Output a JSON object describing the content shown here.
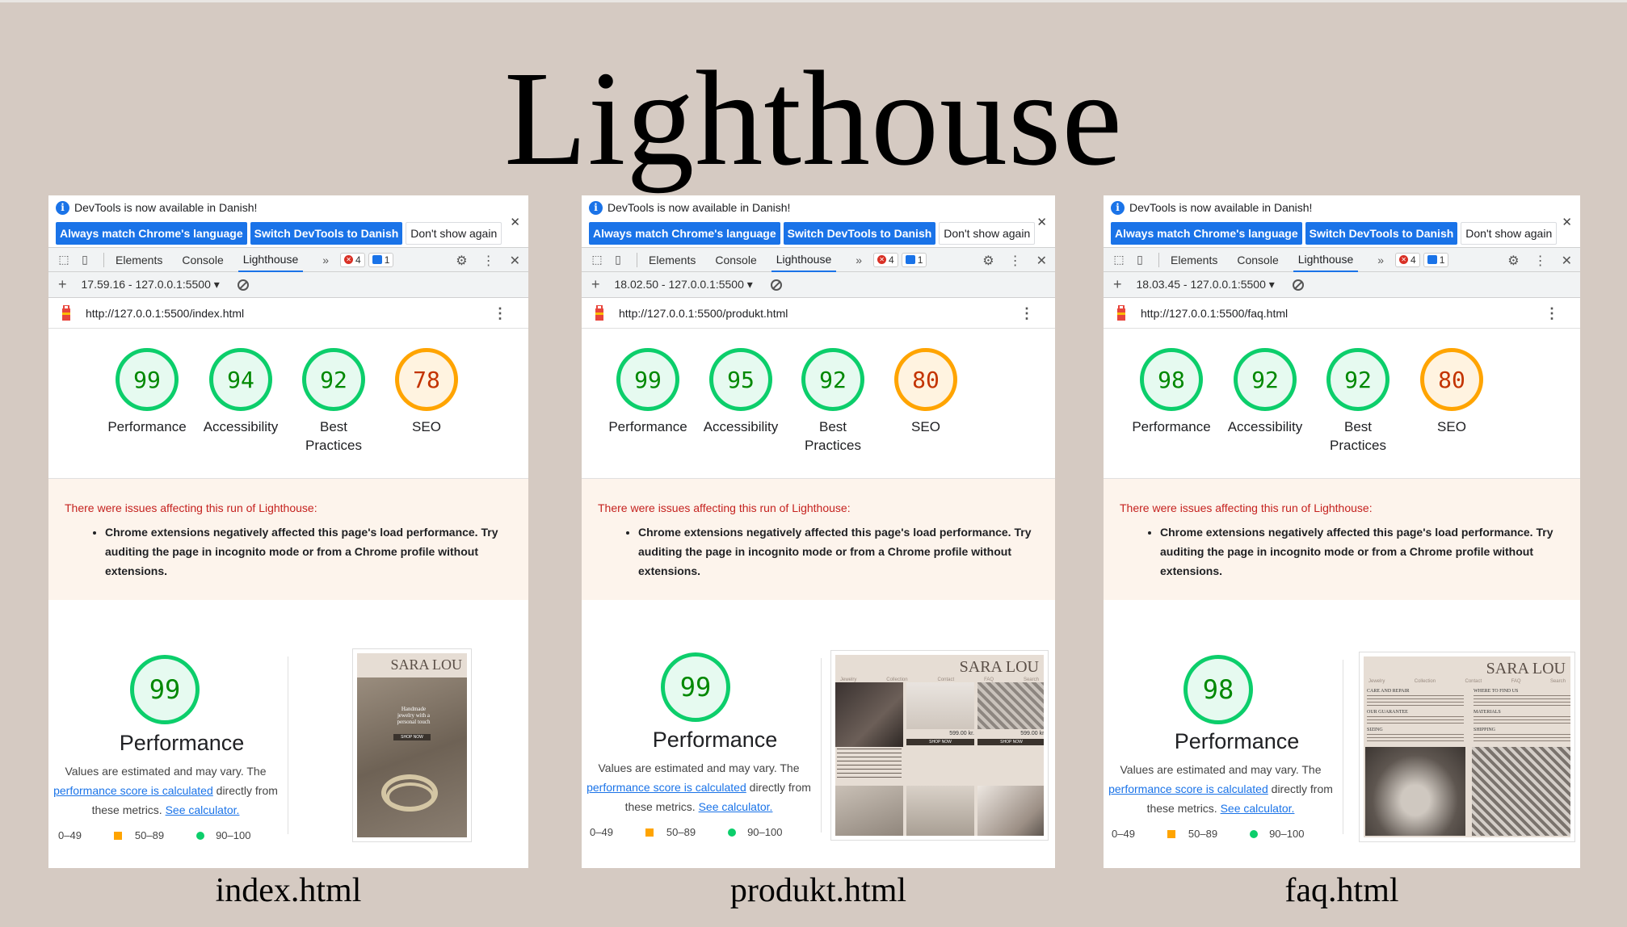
{
  "title": "Lighthouse",
  "common": {
    "banner_text": "DevTools is now available in Danish!",
    "btn_match": "Always match Chrome's language",
    "btn_switch": "Switch DevTools to Danish",
    "btn_dont": "Don't show again",
    "tab_elements": "Elements",
    "tab_console": "Console",
    "tab_lighthouse": "Lighthouse",
    "more_tabs": "»",
    "errors_count": "4",
    "messages_count": "1",
    "label_performance": "Performance",
    "label_accessibility": "Accessibility",
    "label_best_practices": "Best Practices",
    "label_seo": "SEO",
    "warn_title": "There were issues affecting this run of Lighthouse:",
    "warn_item": "Chrome extensions negatively affected this page's load performance. Try auditing the page in incognito mode or from a Chrome profile without extensions.",
    "perf_title": "Performance",
    "desc_pre": "Values are estimated and may vary. The",
    "desc_link": "performance score is calculated",
    "desc_mid": "directly from these metrics.",
    "desc_calc": "See calculator.",
    "legend_low": "0–49",
    "legend_mid": "50–89",
    "legend_high": "90–100",
    "brand": "SARA LOU"
  },
  "panels": [
    {
      "session": "17.59.16 - 127.0.0.1:5500",
      "url": "http://127.0.0.1:5500/index.html",
      "scores": {
        "performance": "99",
        "accessibility": "94",
        "best_practices": "92",
        "seo": "78"
      },
      "perf_score": "99",
      "caption": "index.html"
    },
    {
      "session": "18.02.50 - 127.0.0.1:5500",
      "url": "http://127.0.0.1:5500/produkt.html",
      "scores": {
        "performance": "99",
        "accessibility": "95",
        "best_practices": "92",
        "seo": "80"
      },
      "perf_score": "99",
      "caption": "produkt.html",
      "prices": [
        "599.00 kr.",
        "599.00 kr."
      ]
    },
    {
      "session": "18.03.45 - 127.0.0.1:5500",
      "url": "http://127.0.0.1:5500/faq.html",
      "scores": {
        "performance": "98",
        "accessibility": "92",
        "best_practices": "92",
        "seo": "80"
      },
      "perf_score": "98",
      "caption": "faq.html",
      "faq_headings": [
        "CARE AND REPAIR",
        "WHERE TO FIND US",
        "OUR GUARANTEE",
        "MATERIALS",
        "SIZING",
        "SHIPPING"
      ]
    }
  ],
  "colors": {
    "pass": "#0cce6b",
    "average": "#ffa400",
    "fail_text": "#c5221f",
    "accent": "#1a73e8"
  }
}
